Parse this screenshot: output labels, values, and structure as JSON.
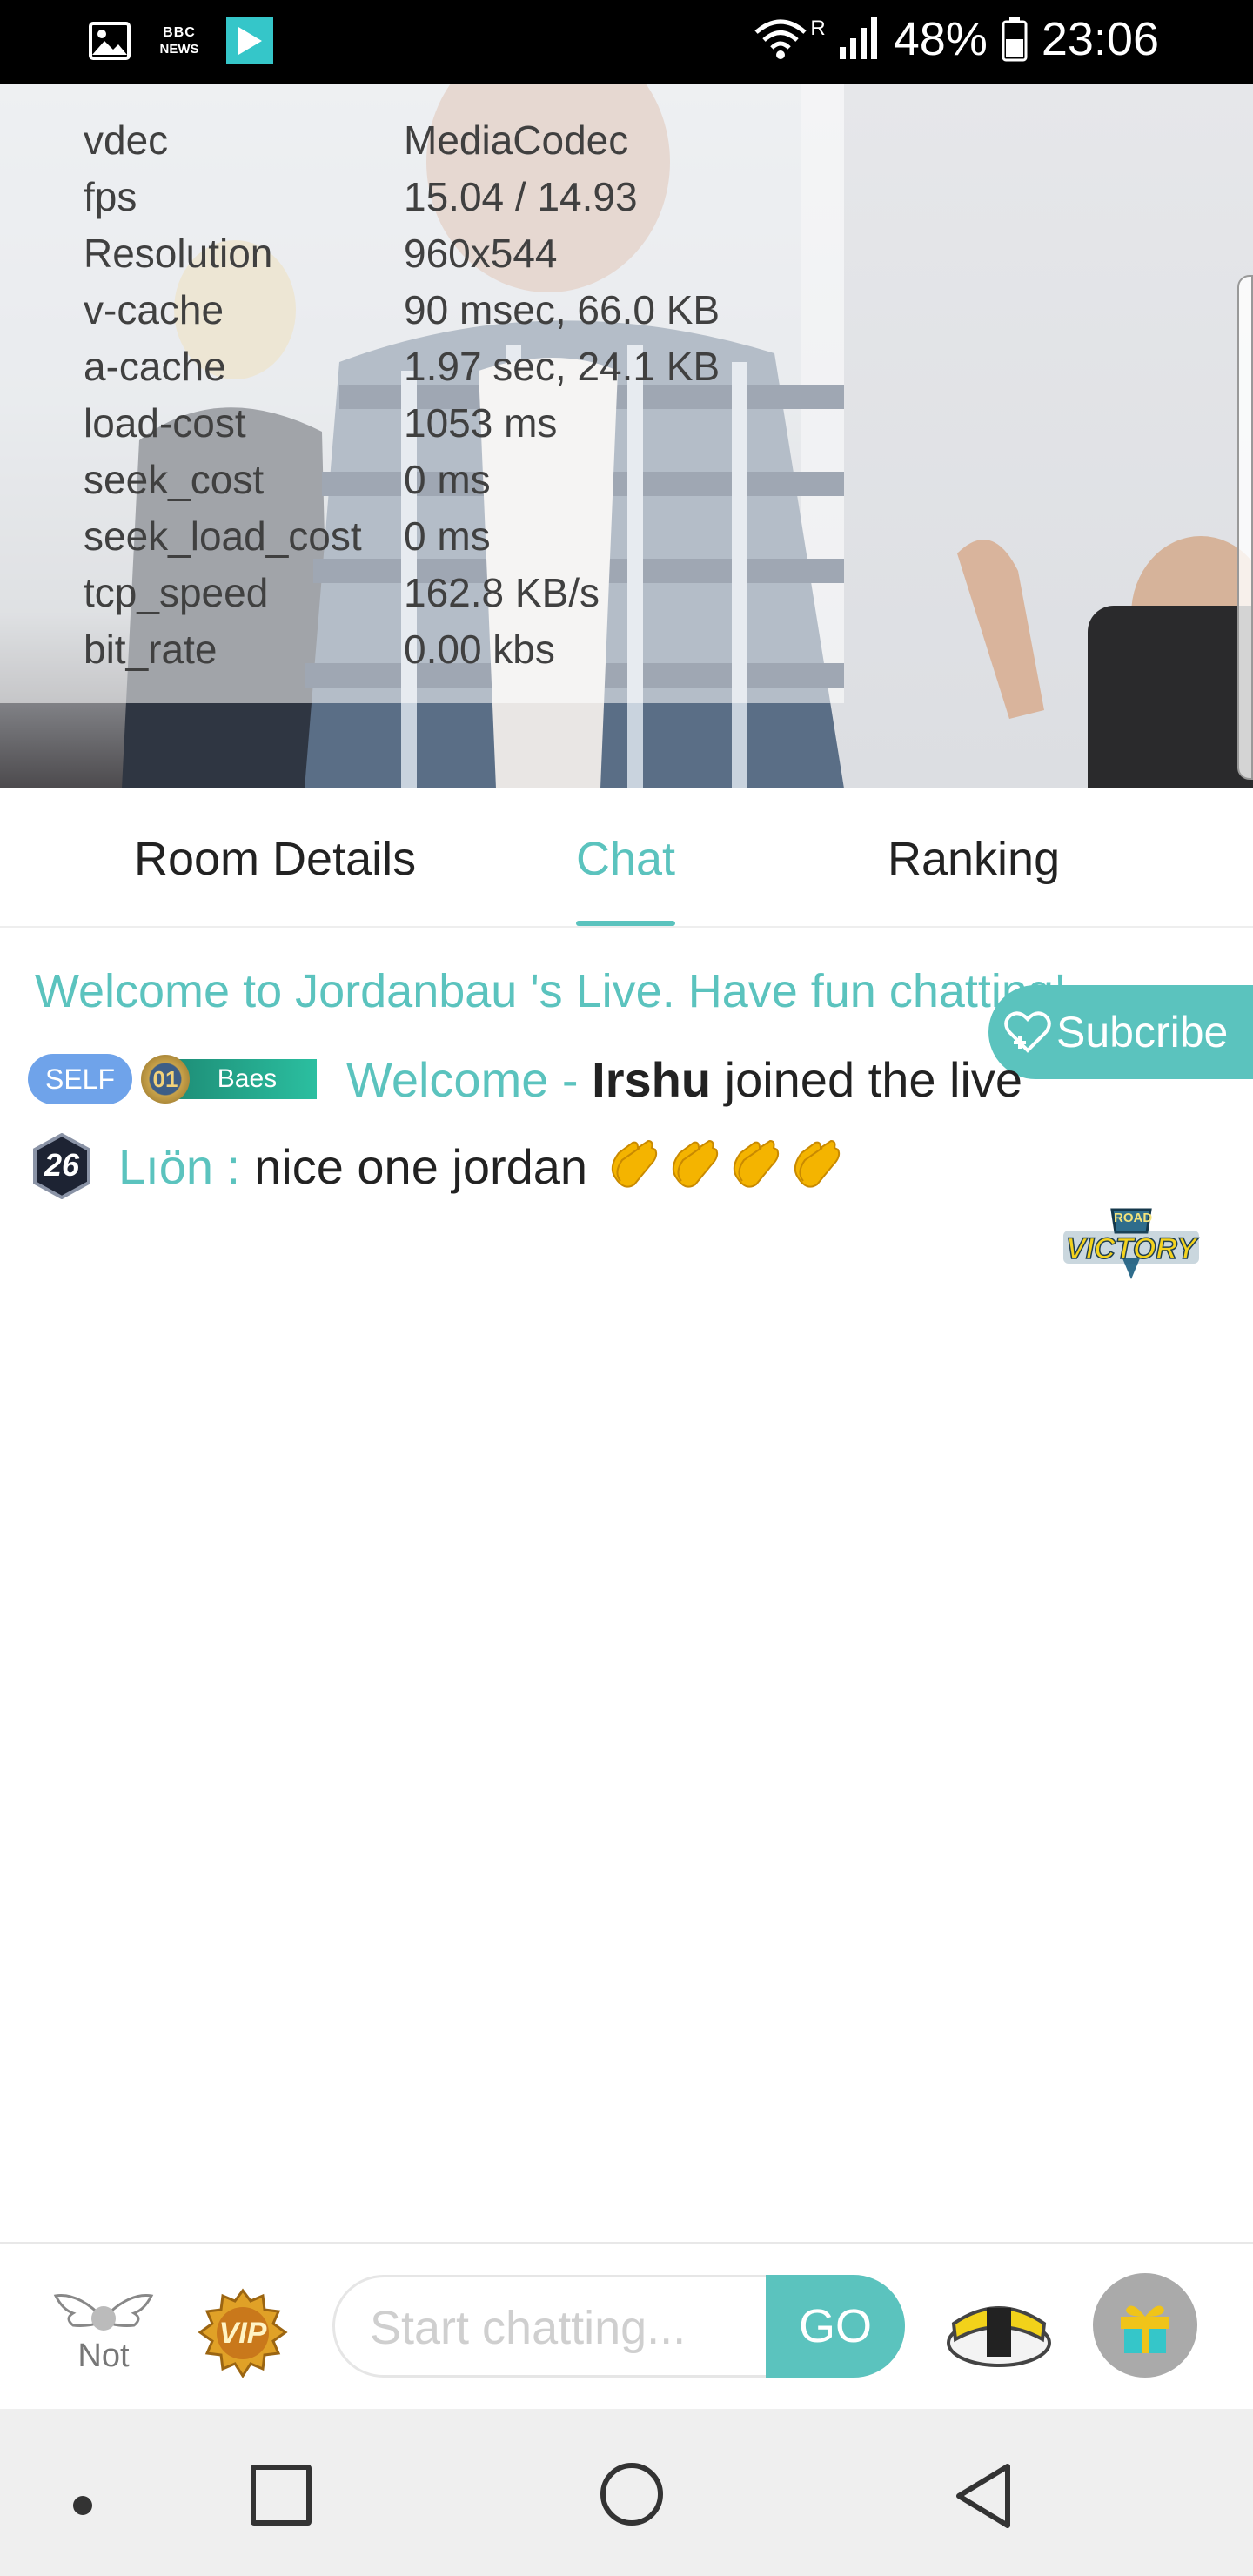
{
  "status_bar": {
    "bbc_line1": "BBC",
    "bbc_line2": "NEWS",
    "network_tag": "R",
    "battery": "48%",
    "time": "23:06"
  },
  "video": {
    "stats": [
      {
        "key": "vdec",
        "value": "MediaCodec"
      },
      {
        "key": "fps",
        "value": "15.04 / 14.93"
      },
      {
        "key": "Resolution",
        "value": "960x544"
      },
      {
        "key": "v-cache",
        "value": "90 msec, 66.0 KB"
      },
      {
        "key": "a-cache",
        "value": "1.97 sec, 24.1 KB"
      },
      {
        "key": "load-cost",
        "value": "1053 ms"
      },
      {
        "key": "seek_cost",
        "value": "0 ms"
      },
      {
        "key": "seek_load_cost",
        "value": "0 ms"
      },
      {
        "key": "tcp_speed",
        "value": "162.8 KB/s"
      },
      {
        "key": "bit_rate",
        "value": "0.00 kbs"
      }
    ]
  },
  "tabs": [
    {
      "label": "Room Details"
    },
    {
      "label": "Chat"
    },
    {
      "label": "Ranking"
    }
  ],
  "chat": {
    "welcome_banner": "Welcome to Jordanbau 's Live. Have fun chatting!",
    "subscribe_label": "Subcribe",
    "join_message": {
      "self_badge": "SELF",
      "level_badge": "01",
      "fan_badge": "Baes",
      "prefix": "Welcome - ",
      "username": "Irshu",
      "suffix": " joined the live"
    },
    "user_message": {
      "level": "26",
      "name": "Lıön : ",
      "text": "nice one jordan"
    },
    "road_line1": "ROAD",
    "road_line2": "VICTORY"
  },
  "bottom_bar": {
    "not_label": "Not",
    "vip_label": "VIP",
    "chat_placeholder": "Start chatting...",
    "go_label": "GO"
  },
  "colors": {
    "accent": "#5bc3be",
    "self_badge": "#6fa3ea",
    "status_bar": "#000000",
    "nav_bar": "#efefef"
  }
}
